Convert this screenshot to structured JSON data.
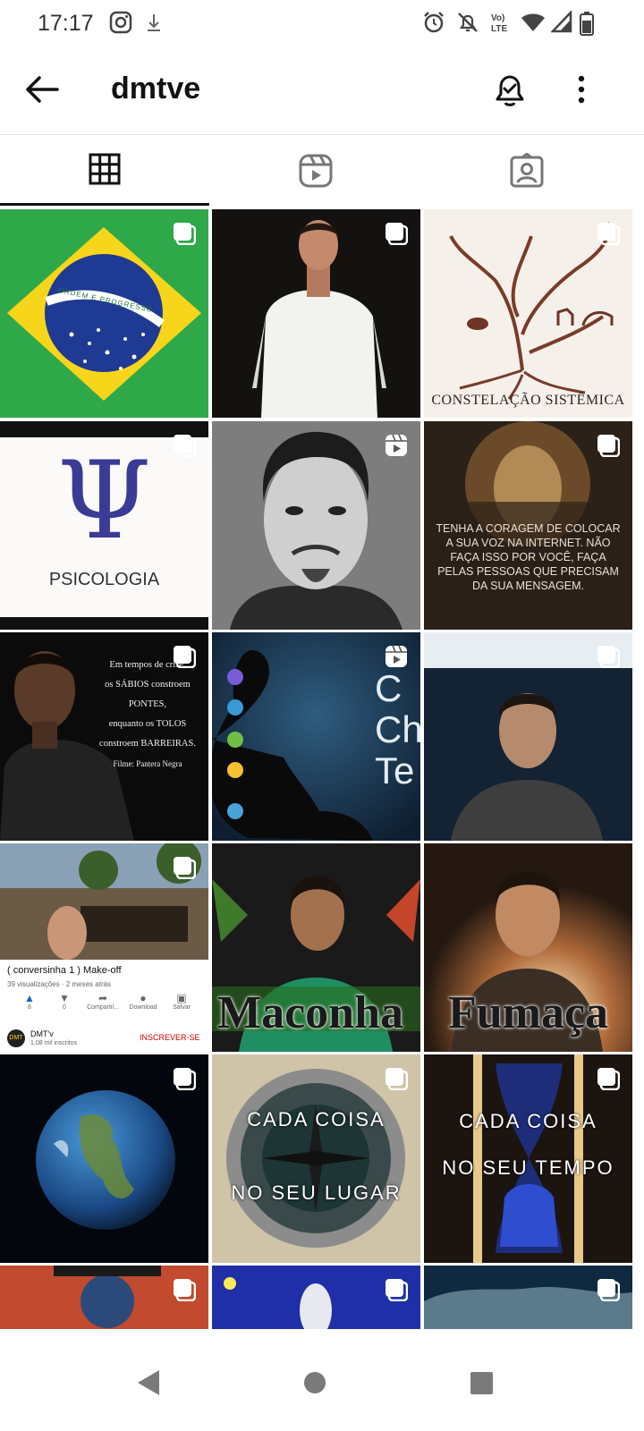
{
  "status_bar": {
    "time": "17:17",
    "left_icons": [
      "instagram-icon",
      "download-icon"
    ],
    "right_icons": [
      "alarm-icon",
      "mute-icon",
      "volte-icon",
      "wifi-icon",
      "signal-icon",
      "battery-icon"
    ],
    "volte_label": "Vo)\nLTE"
  },
  "header": {
    "title": "dmtve",
    "back_icon": "arrow-left-icon",
    "notify_icon": "bell-check-icon",
    "more_icon": "more-vertical-icon"
  },
  "tabs": [
    {
      "name": "grid",
      "icon": "grid-icon",
      "selected": true
    },
    {
      "name": "reels",
      "icon": "reels-icon",
      "selected": false
    },
    {
      "name": "tagged",
      "icon": "tagged-user-icon",
      "selected": false
    }
  ],
  "posts": [
    {
      "label": "flag-brazil",
      "badge": "multi",
      "text": "ORDEM E PROGRESSO"
    },
    {
      "label": "man-white-shirt",
      "badge": "multi"
    },
    {
      "label": "constelacao-tree",
      "badge": "multi",
      "text": "CONSTELAÇÃO SISTÊMICA"
    },
    {
      "label": "psicologia",
      "badge": "multi",
      "text": "PSICOLOGIA",
      "symbol": "Ψ"
    },
    {
      "label": "portrait-bw",
      "badge": "reel"
    },
    {
      "label": "lion-quote",
      "badge": "multi",
      "text": "TENHA A CORAGEM DE COLOCAR A SUA VOZ NA INTERNET. NÃO FAÇA ISSO POR VOCÊ, FAÇA PELAS PESSOAS QUE PRECISAM DA SUA MENSAGEM."
    },
    {
      "label": "pantera-negra",
      "badge": "multi",
      "lines": [
        "Em tempos de crise,",
        "os SÁBIOS constroem PONTES,",
        "enquanto os TOLOS",
        "constroem BARREIRAS.",
        "Filme: Pantera Negra"
      ]
    },
    {
      "label": "chakras",
      "badge": "reel",
      "text": "C Ch Te"
    },
    {
      "label": "video-call",
      "badge": "multi"
    },
    {
      "label": "youtube-makeoff",
      "badge": "multi",
      "video_title": "( conversinha 1 ) Make-off",
      "video_meta": "39 visualizações · 2 meses atrás",
      "actions": [
        "8",
        "0",
        "Compartil...",
        "Download",
        "Salvar"
      ],
      "channel": "DMT'v",
      "subs": "1,08 mil inscritos",
      "subscribe": "INSCREVER-SE"
    },
    {
      "label": "maconha",
      "badge": "none",
      "text": "Maconha"
    },
    {
      "label": "fumaca",
      "badge": "none",
      "text": "Fumaça"
    },
    {
      "label": "earth",
      "badge": "multi"
    },
    {
      "label": "compass",
      "badge": "multi",
      "line1": "CADA COISA",
      "line2": "NO SEU LUGAR"
    },
    {
      "label": "hourglass",
      "badge": "multi",
      "line1": "CADA COISA",
      "line2": "NO SEU TEMPO"
    },
    {
      "label": "partial-1",
      "badge": "multi"
    },
    {
      "label": "partial-2",
      "badge": "multi"
    },
    {
      "label": "partial-3",
      "badge": "multi"
    }
  ],
  "nav": {
    "back": "nav-back-icon",
    "home": "nav-home-icon",
    "recents": "nav-recents-icon"
  }
}
